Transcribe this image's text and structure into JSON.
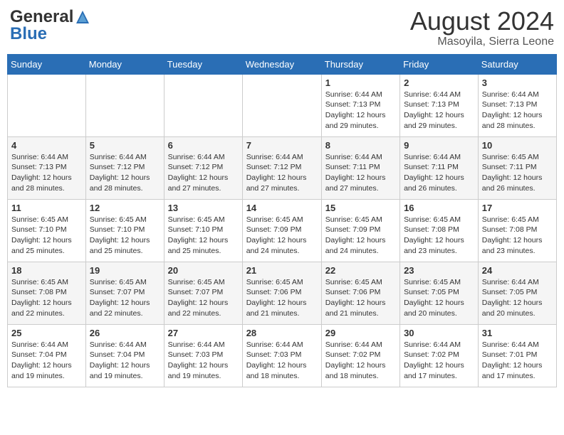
{
  "header": {
    "logo_general": "General",
    "logo_blue": "Blue",
    "month_year": "August 2024",
    "location": "Masoyila, Sierra Leone"
  },
  "days_of_week": [
    "Sunday",
    "Monday",
    "Tuesday",
    "Wednesday",
    "Thursday",
    "Friday",
    "Saturday"
  ],
  "weeks": [
    [
      {
        "day": "",
        "sunrise": "",
        "sunset": "",
        "daylight": ""
      },
      {
        "day": "",
        "sunrise": "",
        "sunset": "",
        "daylight": ""
      },
      {
        "day": "",
        "sunrise": "",
        "sunset": "",
        "daylight": ""
      },
      {
        "day": "",
        "sunrise": "",
        "sunset": "",
        "daylight": ""
      },
      {
        "day": "1",
        "sunrise": "Sunrise: 6:44 AM",
        "sunset": "Sunset: 7:13 PM",
        "daylight": "Daylight: 12 hours and 29 minutes."
      },
      {
        "day": "2",
        "sunrise": "Sunrise: 6:44 AM",
        "sunset": "Sunset: 7:13 PM",
        "daylight": "Daylight: 12 hours and 29 minutes."
      },
      {
        "day": "3",
        "sunrise": "Sunrise: 6:44 AM",
        "sunset": "Sunset: 7:13 PM",
        "daylight": "Daylight: 12 hours and 28 minutes."
      }
    ],
    [
      {
        "day": "4",
        "sunrise": "Sunrise: 6:44 AM",
        "sunset": "Sunset: 7:13 PM",
        "daylight": "Daylight: 12 hours and 28 minutes."
      },
      {
        "day": "5",
        "sunrise": "Sunrise: 6:44 AM",
        "sunset": "Sunset: 7:12 PM",
        "daylight": "Daylight: 12 hours and 28 minutes."
      },
      {
        "day": "6",
        "sunrise": "Sunrise: 6:44 AM",
        "sunset": "Sunset: 7:12 PM",
        "daylight": "Daylight: 12 hours and 27 minutes."
      },
      {
        "day": "7",
        "sunrise": "Sunrise: 6:44 AM",
        "sunset": "Sunset: 7:12 PM",
        "daylight": "Daylight: 12 hours and 27 minutes."
      },
      {
        "day": "8",
        "sunrise": "Sunrise: 6:44 AM",
        "sunset": "Sunset: 7:11 PM",
        "daylight": "Daylight: 12 hours and 27 minutes."
      },
      {
        "day": "9",
        "sunrise": "Sunrise: 6:44 AM",
        "sunset": "Sunset: 7:11 PM",
        "daylight": "Daylight: 12 hours and 26 minutes."
      },
      {
        "day": "10",
        "sunrise": "Sunrise: 6:45 AM",
        "sunset": "Sunset: 7:11 PM",
        "daylight": "Daylight: 12 hours and 26 minutes."
      }
    ],
    [
      {
        "day": "11",
        "sunrise": "Sunrise: 6:45 AM",
        "sunset": "Sunset: 7:10 PM",
        "daylight": "Daylight: 12 hours and 25 minutes."
      },
      {
        "day": "12",
        "sunrise": "Sunrise: 6:45 AM",
        "sunset": "Sunset: 7:10 PM",
        "daylight": "Daylight: 12 hours and 25 minutes."
      },
      {
        "day": "13",
        "sunrise": "Sunrise: 6:45 AM",
        "sunset": "Sunset: 7:10 PM",
        "daylight": "Daylight: 12 hours and 25 minutes."
      },
      {
        "day": "14",
        "sunrise": "Sunrise: 6:45 AM",
        "sunset": "Sunset: 7:09 PM",
        "daylight": "Daylight: 12 hours and 24 minutes."
      },
      {
        "day": "15",
        "sunrise": "Sunrise: 6:45 AM",
        "sunset": "Sunset: 7:09 PM",
        "daylight": "Daylight: 12 hours and 24 minutes."
      },
      {
        "day": "16",
        "sunrise": "Sunrise: 6:45 AM",
        "sunset": "Sunset: 7:08 PM",
        "daylight": "Daylight: 12 hours and 23 minutes."
      },
      {
        "day": "17",
        "sunrise": "Sunrise: 6:45 AM",
        "sunset": "Sunset: 7:08 PM",
        "daylight": "Daylight: 12 hours and 23 minutes."
      }
    ],
    [
      {
        "day": "18",
        "sunrise": "Sunrise: 6:45 AM",
        "sunset": "Sunset: 7:08 PM",
        "daylight": "Daylight: 12 hours and 22 minutes."
      },
      {
        "day": "19",
        "sunrise": "Sunrise: 6:45 AM",
        "sunset": "Sunset: 7:07 PM",
        "daylight": "Daylight: 12 hours and 22 minutes."
      },
      {
        "day": "20",
        "sunrise": "Sunrise: 6:45 AM",
        "sunset": "Sunset: 7:07 PM",
        "daylight": "Daylight: 12 hours and 22 minutes."
      },
      {
        "day": "21",
        "sunrise": "Sunrise: 6:45 AM",
        "sunset": "Sunset: 7:06 PM",
        "daylight": "Daylight: 12 hours and 21 minutes."
      },
      {
        "day": "22",
        "sunrise": "Sunrise: 6:45 AM",
        "sunset": "Sunset: 7:06 PM",
        "daylight": "Daylight: 12 hours and 21 minutes."
      },
      {
        "day": "23",
        "sunrise": "Sunrise: 6:45 AM",
        "sunset": "Sunset: 7:05 PM",
        "daylight": "Daylight: 12 hours and 20 minutes."
      },
      {
        "day": "24",
        "sunrise": "Sunrise: 6:44 AM",
        "sunset": "Sunset: 7:05 PM",
        "daylight": "Daylight: 12 hours and 20 minutes."
      }
    ],
    [
      {
        "day": "25",
        "sunrise": "Sunrise: 6:44 AM",
        "sunset": "Sunset: 7:04 PM",
        "daylight": "Daylight: 12 hours and 19 minutes."
      },
      {
        "day": "26",
        "sunrise": "Sunrise: 6:44 AM",
        "sunset": "Sunset: 7:04 PM",
        "daylight": "Daylight: 12 hours and 19 minutes."
      },
      {
        "day": "27",
        "sunrise": "Sunrise: 6:44 AM",
        "sunset": "Sunset: 7:03 PM",
        "daylight": "Daylight: 12 hours and 19 minutes."
      },
      {
        "day": "28",
        "sunrise": "Sunrise: 6:44 AM",
        "sunset": "Sunset: 7:03 PM",
        "daylight": "Daylight: 12 hours and 18 minutes."
      },
      {
        "day": "29",
        "sunrise": "Sunrise: 6:44 AM",
        "sunset": "Sunset: 7:02 PM",
        "daylight": "Daylight: 12 hours and 18 minutes."
      },
      {
        "day": "30",
        "sunrise": "Sunrise: 6:44 AM",
        "sunset": "Sunset: 7:02 PM",
        "daylight": "Daylight: 12 hours and 17 minutes."
      },
      {
        "day": "31",
        "sunrise": "Sunrise: 6:44 AM",
        "sunset": "Sunset: 7:01 PM",
        "daylight": "Daylight: 12 hours and 17 minutes."
      }
    ]
  ]
}
